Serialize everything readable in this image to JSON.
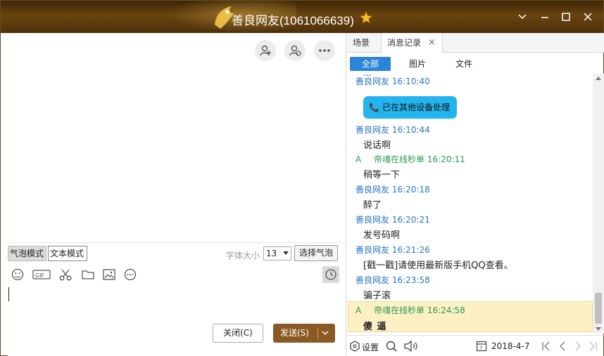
{
  "window": {
    "title": "善良网友(1061066639)"
  },
  "left": {
    "header_icons": [
      "add-friend-icon",
      "invite-icon",
      "more-icon"
    ],
    "modes": {
      "bubble": "气泡模式",
      "text": "文本模式"
    },
    "font_size_label": "字体大小",
    "font_size_value": "13",
    "select_bubble": "选择气泡",
    "toolbar_icons": [
      "emoji-icon",
      "gif-icon",
      "scissors-icon",
      "folder-icon",
      "image-icon",
      "more-icon"
    ],
    "close_button": "关闭(C)",
    "send_button": "发送(S)"
  },
  "right": {
    "tabs": {
      "scene": "场景",
      "history": "消息记录"
    },
    "filters": {
      "all": "全部",
      "images": "图片",
      "files": "文件"
    },
    "partial_top": "...",
    "messages": [
      {
        "sender": "善良网友",
        "time": "16:10:40",
        "self": false,
        "text": "已在其他设备处理",
        "call": true
      },
      {
        "sender": "善良网友",
        "time": "16:10:44",
        "self": false,
        "text": "说话啊"
      },
      {
        "prefix": "A",
        "sender": "帝魂在线秒单",
        "time": "16:20:11",
        "self": true,
        "text": "稍等一下"
      },
      {
        "sender": "善良网友",
        "time": "16:20:18",
        "self": false,
        "text": "醉了"
      },
      {
        "sender": "善良网友",
        "time": "16:20:21",
        "self": false,
        "text": "发号码啊"
      },
      {
        "sender": "善良网友",
        "time": "16:21:26",
        "self": false,
        "text": "[戳一戳]请使用最新版手机QQ查看。"
      },
      {
        "sender": "善良网友",
        "time": "16:23:58",
        "self": false,
        "text": "骗子滚"
      },
      {
        "prefix": "A",
        "sender": "帝魂在线秒单",
        "time": "16:24:58",
        "self": true,
        "text": "傻 逼",
        "highlight": true
      }
    ],
    "bottom": {
      "settings": "设置",
      "date": "2018-4-7"
    }
  },
  "colors": {
    "title_bar": "#4c300a",
    "link_blue": "#2777c8",
    "self_green": "#2a9a52",
    "filter_active": "#2a84d8",
    "call_bubble": "#23b4ee",
    "send_button": "#8b5a24",
    "highlight_row": "#fdf0c4"
  }
}
